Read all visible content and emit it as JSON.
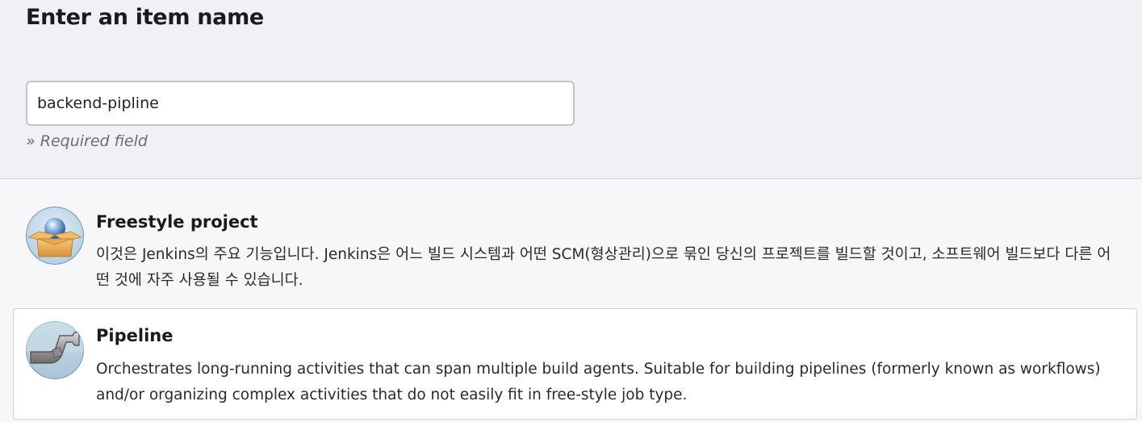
{
  "header": {
    "title": "Enter an item name"
  },
  "name_field": {
    "value": "backend-pipline",
    "hint": "» Required field"
  },
  "item_types": [
    {
      "icon": "freestyle-project-icon",
      "title": "Freestyle project",
      "description": "이것은 Jenkins의 주요 기능입니다. Jenkins은 어느 빌드 시스템과 어떤 SCM(형상관리)으로 묶인 당신의 프로젝트를 빌드할 것이고, 소프트웨어 빌드보다 다른 어떤 것에 자주 사용될 수 있습니다."
    },
    {
      "icon": "pipeline-icon",
      "title": "Pipeline",
      "description": "Orchestrates long-running activities that can span multiple build agents. Suitable for building pipelines (formerly known as workflows) and/or organizing complex activities that do not easily fit in free-style job type."
    }
  ],
  "colors": {
    "top_panel": "#f1f1f5",
    "page_background": "#f7f7f9",
    "selected_item": "#ffffff",
    "input_border": "#c2c4c8",
    "hint_text": "#6e6e6e"
  }
}
